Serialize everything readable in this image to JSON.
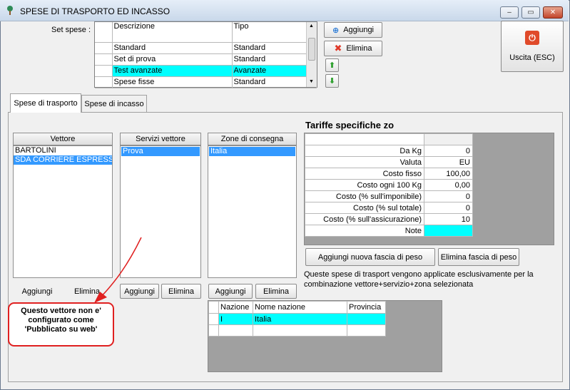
{
  "window": {
    "title": "SPESE DI TRASPORTO ED INCASSO",
    "controls": {
      "minimize": "‒",
      "maximize": "▭",
      "close": "✕"
    }
  },
  "set_spese": {
    "label": "Set spese :",
    "columns": [
      "Descrizione",
      "Tipo"
    ],
    "rows": [
      {
        "descrizione": "Standard",
        "tipo": "Standard"
      },
      {
        "descrizione": "Set di prova",
        "tipo": "Standard"
      },
      {
        "descrizione": "Test avanzate",
        "tipo": "Avanzate"
      },
      {
        "descrizione": "Spese fisse",
        "tipo": "Standard"
      }
    ],
    "selected_index": 2,
    "aggiungi_label": "Aggiungi",
    "elimina_label": "Elimina"
  },
  "exit_button": {
    "label": "Uscita (ESC)"
  },
  "tabs": [
    {
      "label": "Spese di trasporto"
    },
    {
      "label": "Spese di incasso"
    }
  ],
  "vettore": {
    "header": "Vettore",
    "items": [
      "BARTOLINI",
      "SDA CORRIERE ESPRESSO"
    ],
    "selected_index": 1,
    "aggiungi_label": "Aggiungi",
    "elimina_label": "Elimina"
  },
  "servizi": {
    "header": "Servizi vettore",
    "items": [
      "Prova"
    ],
    "aggiungi_label": "Aggiungi",
    "elimina_label": "Elimina"
  },
  "zone": {
    "header": "Zone di consegna",
    "items": [
      "Italia"
    ],
    "aggiungi_label": "Aggiungi",
    "elimina_label": "Elimina"
  },
  "tariffe": {
    "title": "Tariffe specifiche zo",
    "rows": [
      {
        "label": "Da Kg",
        "value": "0"
      },
      {
        "label": "Valuta",
        "value": "EU"
      },
      {
        "label": "Costo fisso",
        "value": "100,00"
      },
      {
        "label": "Costo ogni 100 Kg",
        "value": "0,00"
      },
      {
        "label": "Costo (% sull'imponibile)",
        "value": "0"
      },
      {
        "label": "Costo (% sul totale)",
        "value": "0"
      },
      {
        "label": "Costo (% sull'assicurazione)",
        "value": "10"
      },
      {
        "label": "Note",
        "value": ""
      }
    ],
    "aggiungi_fascia_label": "Aggiungi nuova fascia di peso",
    "elimina_fascia_label": "Elimina fascia di peso",
    "info_line1": "Queste spese di trasport vengono applicate esclusivamente per la",
    "info_line2": "combinazione vettore+servizio+zona selezionata"
  },
  "nazioni": {
    "columns": [
      "Nazione",
      "Nome nazione",
      "Provincia"
    ],
    "rows": [
      {
        "nazione": "I",
        "nome": "Italia",
        "provincia": ""
      }
    ]
  },
  "callout": {
    "line1": "Questo vettore non e'",
    "line2": "configurato come",
    "line3": "'Pubblicato su web'"
  },
  "colors": {
    "selection_cyan": "#00ffff",
    "selection_blue": "#3399ff",
    "callout_red": "#e02020"
  }
}
